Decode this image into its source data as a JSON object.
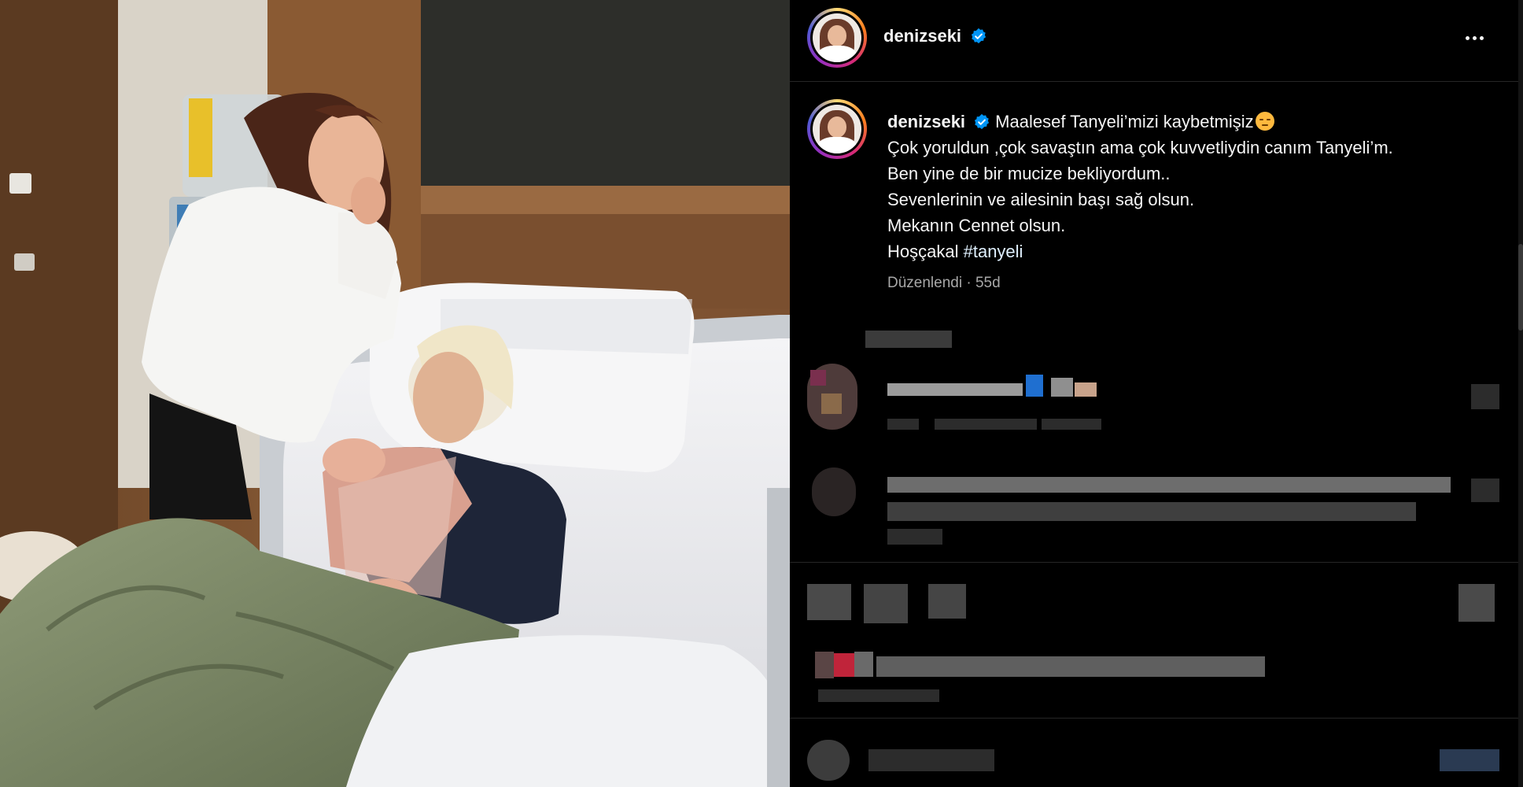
{
  "post": {
    "username": "denizseki",
    "verified": true,
    "more_icon": "more-horizontal-icon",
    "caption": {
      "first_line": "Maalesef Tanyeli’mizi kaybetmişiz",
      "emoji": "pensive-face",
      "lines": [
        "Çok yoruldun ,çok savaştın ama çok kuvvetliydin canım Tanyeli’m.",
        "Ben yine de bir mucize bekliyordum..",
        "Sevenlerinin ve ailesinin başı sağ olsun.",
        "Mekanın Cennet olsun."
      ],
      "last_line_text": "Hoşçakal",
      "hashtag": "#tanyeli"
    },
    "edited_label": "Düzenlendi",
    "separator": "·",
    "age": "55d"
  },
  "colors": {
    "background": "#000000",
    "text": "#f5f5f5",
    "secondary_text": "#a8a8a8",
    "verified_badge": "#0095f6",
    "hashtag": "#e0f1ff"
  }
}
